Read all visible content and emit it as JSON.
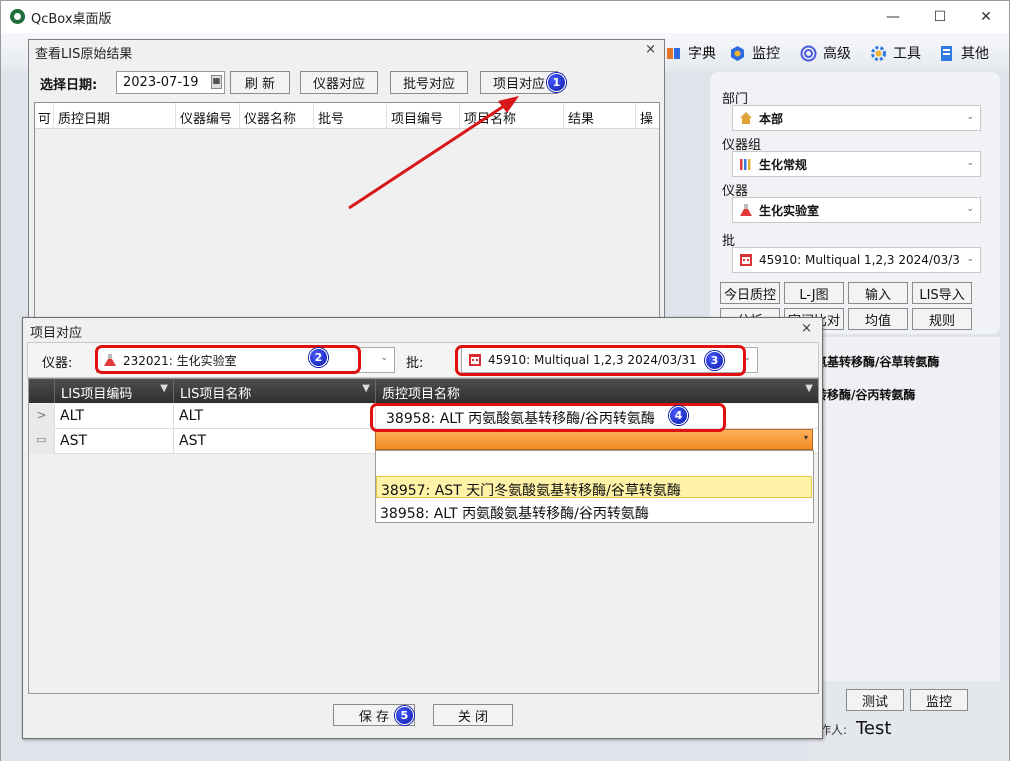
{
  "app": {
    "title": "QcBox桌面版"
  },
  "window_controls": {
    "minimize": "—",
    "maximize": "☐",
    "close": "✕"
  },
  "menu": [
    {
      "label": "字典",
      "icon": "book-icon"
    },
    {
      "label": "监控",
      "icon": "monitor-hex-icon"
    },
    {
      "label": "高级",
      "icon": "target-icon"
    },
    {
      "label": "工具",
      "icon": "gear-icon"
    },
    {
      "label": "其他",
      "icon": "document-icon"
    }
  ],
  "right_panel": {
    "dept_label": "部门",
    "dept_value": "本部",
    "group_label": "仪器组",
    "group_value": "生化常规",
    "instrument_label": "仪器",
    "instrument_value": "生化实验室",
    "batch_label": "批",
    "batch_value": "45910:  Multiqual 1,2,3  2024/03/3",
    "buttons_row1": [
      "今日质控",
      "L-J图",
      "输入",
      "LIS导入"
    ],
    "buttons_row2": [
      "分析",
      "室间比对",
      "均值",
      "规则"
    ],
    "list": [
      "氨基转移酶/谷草转氨酶",
      "转移酶/谷丙转氨酶"
    ],
    "bottom_buttons": [
      "测试",
      "监控"
    ],
    "operator_label": "作人:",
    "operator_value": "Test"
  },
  "lis_window": {
    "title": "查看LIS原始结果",
    "close": "×",
    "date_label": "选择日期:",
    "date_value": "2023-07-19",
    "buttons": [
      "刷 新",
      "仪器对应",
      "批号对应",
      "项目对应"
    ],
    "columns": [
      "可",
      "质控日期",
      "仪器编号",
      "仪器名称",
      "批号",
      "项目编号",
      "项目名称",
      "结果",
      "操"
    ]
  },
  "mapping_dialog": {
    "title": "项目对应",
    "close": "×",
    "instrument_label": "仪器:",
    "instrument_value": "232021:  生化实验室",
    "batch_label": "批:",
    "batch_value": "45910:  Multiqual 1,2,3  2024/03/31",
    "columns": [
      "LIS项目编码",
      "LIS项目名称",
      "质控项目名称"
    ],
    "rows": [
      {
        "indicator": ">",
        "code": "ALT",
        "name": "ALT",
        "qc_item": "38958: ALT 丙氨酸氨基转移酶/谷丙转氨酶"
      },
      {
        "indicator": "▭",
        "code": "AST",
        "name": "AST",
        "qc_item": ""
      }
    ],
    "dropdown_options": [
      "38957: AST 天门冬氨酸氨基转移酶/谷草转氨酶",
      "38958: ALT 丙氨酸氨基转移酶/谷丙转氨酶"
    ],
    "save_label": "保 存",
    "close_label": "关 闭"
  },
  "annotations": [
    "1",
    "2",
    "3",
    "4",
    "5"
  ],
  "colors": {
    "callout": "#e01010",
    "badge": "#0a1aa8",
    "highlight": "#fff3a8",
    "orange": "#f59a3a"
  }
}
